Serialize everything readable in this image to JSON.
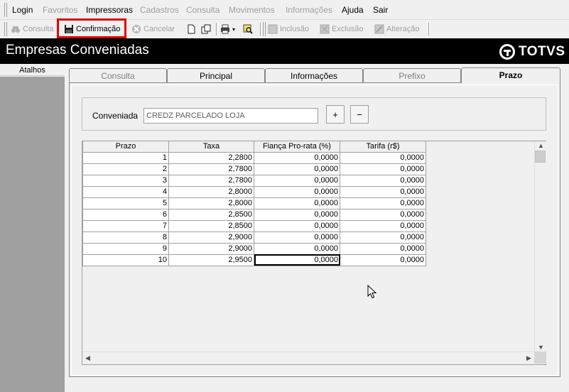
{
  "menu": {
    "items": [
      {
        "label": "Login",
        "enabled": true
      },
      {
        "label": "Favoritos",
        "enabled": false
      },
      {
        "label": "Impressoras",
        "enabled": true
      },
      {
        "label": "Cadastros",
        "enabled": false
      },
      {
        "label": "Consulta",
        "enabled": false
      },
      {
        "label": "Movimentos",
        "enabled": false
      },
      {
        "label": "Informações",
        "enabled": false
      },
      {
        "label": "Ajuda",
        "enabled": true
      },
      {
        "label": "Sair",
        "enabled": true
      }
    ]
  },
  "toolbar": {
    "consulta": "Consulta",
    "confirmacao": "Confirmação",
    "cancelar": "Cancelar",
    "inclusao": "Inclusão",
    "exclusao": "Exclusão",
    "alteracao": "Alteração"
  },
  "window": {
    "title": "Empresas Conveniadas",
    "logo_text": "TOTVS"
  },
  "left_panel": {
    "header": "Atalhos"
  },
  "tabs": [
    {
      "label": "Consulta",
      "active": false,
      "enabled": false
    },
    {
      "label": "Principal",
      "active": false,
      "enabled": true
    },
    {
      "label": "Informações",
      "active": false,
      "enabled": true
    },
    {
      "label": "Prefixo",
      "active": false,
      "enabled": false
    },
    {
      "label": "Prazo",
      "active": true,
      "enabled": true
    }
  ],
  "form": {
    "conveniada_label": "Conveniada",
    "conveniada_value": "CREDZ PARCELADO LOJA",
    "add_label": "+",
    "remove_label": "−"
  },
  "grid": {
    "columns": [
      "Prazo",
      "Taxa",
      "Fiança Pro-rata (%)",
      "Tarifa (r$)"
    ],
    "rows": [
      [
        "1",
        "2,2800",
        "0,0000",
        "0,0000"
      ],
      [
        "2",
        "2,7800",
        "0,0000",
        "0,0000"
      ],
      [
        "3",
        "2,7800",
        "0,0000",
        "0,0000"
      ],
      [
        "4",
        "2,8000",
        "0,0000",
        "0,0000"
      ],
      [
        "5",
        "2,8000",
        "0,0000",
        "0,0000"
      ],
      [
        "6",
        "2,8500",
        "0,0000",
        "0,0000"
      ],
      [
        "7",
        "2,8500",
        "0,0000",
        "0,0000"
      ],
      [
        "8",
        "2,9000",
        "0,0000",
        "0,0000"
      ],
      [
        "9",
        "2,9000",
        "0,0000",
        "0,0000"
      ],
      [
        "10",
        "2,9500",
        "0,0000",
        "0,0000"
      ]
    ]
  },
  "colors": {
    "highlight": "#e00000",
    "titlebar": "#000000",
    "left_pane": "#a0a0a0"
  }
}
